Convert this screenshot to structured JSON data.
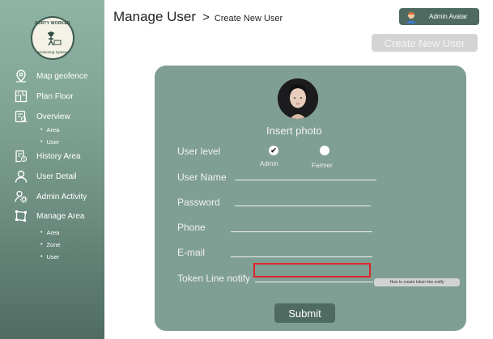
{
  "sidebar": {
    "logo": {
      "top_text": "FORTY WORKER",
      "bottom_text": "Monitoring System"
    },
    "items": [
      {
        "label": "Map geofence",
        "icon": "map-pin-icon"
      },
      {
        "label": "Plan Floor",
        "icon": "floor-plan-icon"
      },
      {
        "label": "Overview",
        "icon": "overview-icon",
        "sub": [
          "Area",
          "User"
        ]
      },
      {
        "label": "History Area",
        "icon": "history-icon"
      },
      {
        "label": "User Detail",
        "icon": "user-icon"
      },
      {
        "label": "Admin Activity",
        "icon": "admin-activity-icon"
      },
      {
        "label": "Manage Area",
        "icon": "manage-area-icon",
        "sub": [
          "Area",
          "Zone",
          "User"
        ]
      }
    ]
  },
  "header": {
    "title": "Manage User",
    "separator": ">",
    "breadcrumb": "Create New User",
    "admin_label": "Admin Avatar",
    "create_button": "Create New User"
  },
  "form": {
    "insert_photo": "Insert photo",
    "user_level_label": "User level",
    "user_level_options": [
      "Admin",
      "Farmer"
    ],
    "user_level_selected": "Admin",
    "fields": {
      "user_name": {
        "label": "User Name",
        "value": ""
      },
      "password": {
        "label": "Password",
        "value": ""
      },
      "phone": {
        "label": "Phone",
        "value": ""
      },
      "email": {
        "label": "E-mail",
        "value": ""
      },
      "token": {
        "label": "Token Line notify",
        "value": ""
      }
    },
    "howto_button": "How to create token line notify",
    "submit_button": "Submit"
  },
  "colors": {
    "sidebar_top": "#8fb4a6",
    "sidebar_bottom": "#4f6c62",
    "card": "#7f9e94",
    "button_dark": "#4f6b61",
    "highlight": "#e0242b"
  }
}
